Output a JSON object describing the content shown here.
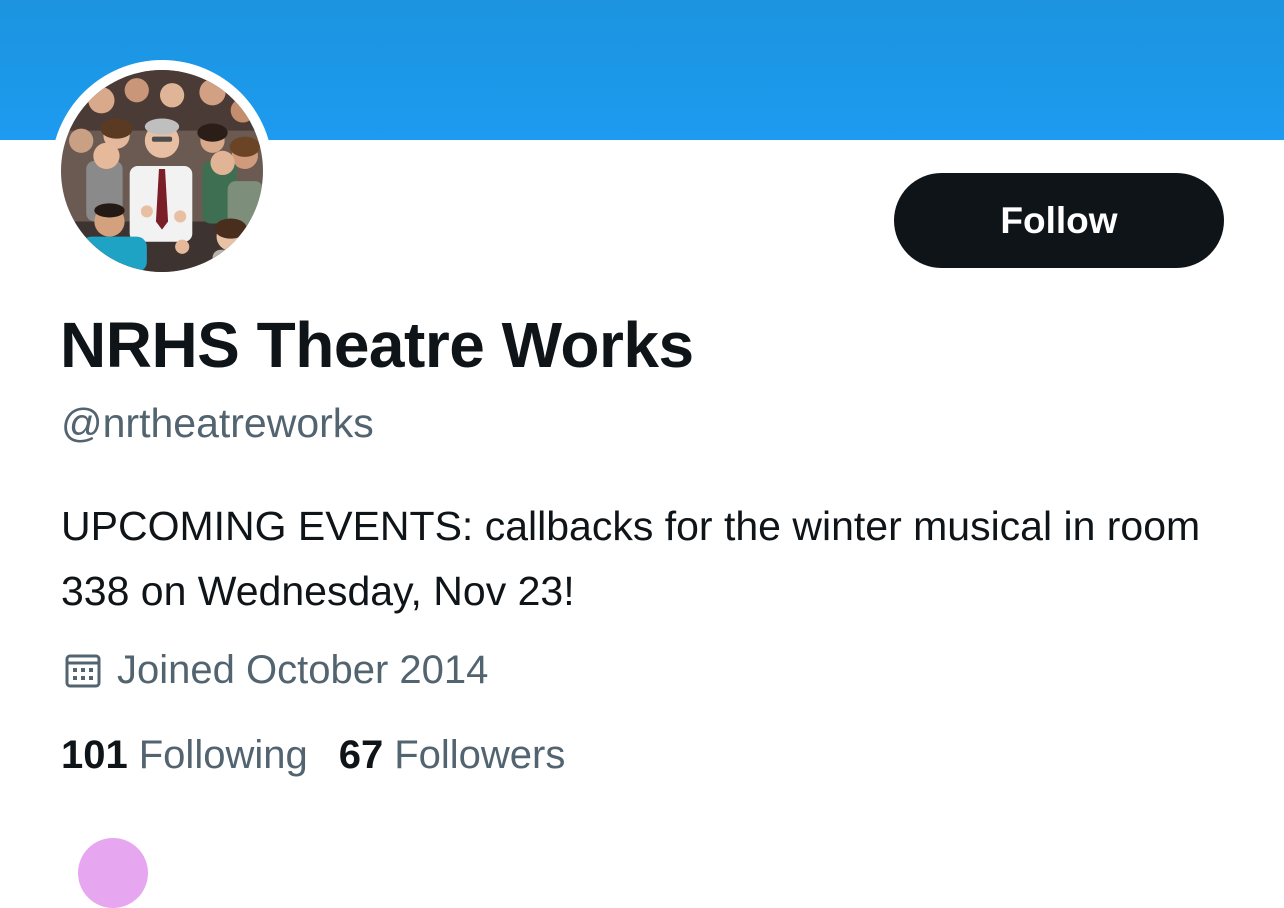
{
  "profile": {
    "display_name": "NRHS Theatre Works",
    "handle": "@nrtheatreworks",
    "bio": "UPCOMING EVENTS: callbacks for the winter musical in room 338 on Wednesday, Nov 23!",
    "joined": "Joined October 2014"
  },
  "actions": {
    "follow_label": "Follow"
  },
  "stats": {
    "following_count": "101",
    "following_label": "Following",
    "followers_count": "67",
    "followers_label": "Followers"
  },
  "icons": {
    "joined": "calendar-icon"
  },
  "colors": {
    "banner": "#1d9bf0",
    "primary_text": "#0f1419",
    "secondary_text": "#536471",
    "follow_button_bg": "#0f1419",
    "follow_button_text": "#ffffff"
  }
}
